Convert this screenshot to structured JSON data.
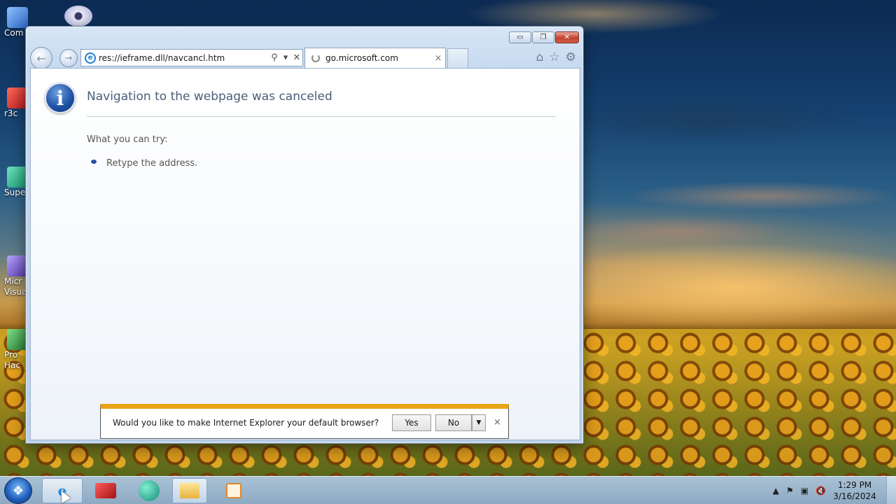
{
  "desktop": {
    "icons": [
      {
        "label": "Com",
        "icon": "computer-icon",
        "color": "#3a6fc8"
      },
      {
        "label": "r3c",
        "icon": "app-shortcut-icon",
        "color": "#c8282a"
      },
      {
        "label": "Super",
        "icon": "app-shortcut-icon",
        "color": "#1fa87a"
      },
      {
        "label": "Micr\nVisual",
        "icon": "visual-studio-icon",
        "color": "#6a4fb0"
      },
      {
        "label": "Pro\nHac",
        "icon": "app-shortcut-icon",
        "color": "#2f8a3a"
      }
    ],
    "dvd_icon": "dvd-drive-icon"
  },
  "browser": {
    "address_url": "res://ieframe.dll/navcancl.htm",
    "tab_title": "go.microsoft.com",
    "tab_close": "×",
    "address_search_glyph": "⚲",
    "address_dropdown_glyph": "▾",
    "address_close_glyph": "✕",
    "caption": {
      "minimize": "▭",
      "restore": "❐",
      "close": "✕"
    },
    "tools": {
      "home": "⌂",
      "favorites": "☆",
      "settings": "⚙"
    }
  },
  "page": {
    "title": "Navigation to the webpage was canceled",
    "what_you_can_try": "What you can try:",
    "suggestions": [
      "Retype the address."
    ],
    "info_glyph": "i"
  },
  "notification": {
    "message": "Would you like to make Internet Explorer your default browser?",
    "yes_label": "Yes",
    "no_label": "No",
    "dropdown_glyph": "▼",
    "close_glyph": "×",
    "accent_color": "#e9a51a"
  },
  "taskbar": {
    "items": [
      {
        "name": "internet-explorer",
        "active": true
      },
      {
        "name": "security-app",
        "active": false
      },
      {
        "name": "edge-like-browser",
        "active": false
      },
      {
        "name": "file-explorer",
        "active": false
      },
      {
        "name": "media-player",
        "active": false
      }
    ],
    "clock_time": "1:29 PM",
    "clock_date": "3/16/2024"
  }
}
